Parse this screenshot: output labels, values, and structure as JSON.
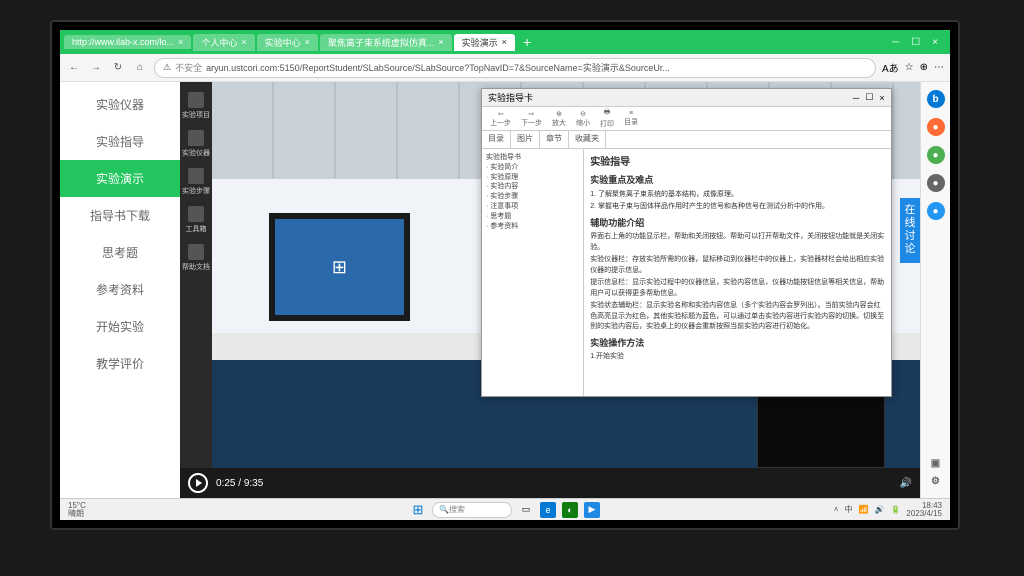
{
  "tabs": [
    {
      "label": "http://www.ilab-x.com/lo..."
    },
    {
      "label": "个人中心"
    },
    {
      "label": "实验中心"
    },
    {
      "label": "聚焦离子束系统虚拟仿真..."
    },
    {
      "label": "实验演示"
    }
  ],
  "addr": {
    "security": "不安全",
    "url": "aryun.ustcori.com:5150/ReportStudent/SLabSource/SLabSource?TopNavID=7&SourceName=实验演示&SourceUr..."
  },
  "leftMenu": [
    "实验仪器",
    "实验指导",
    "实验演示",
    "指导书下载",
    "思考题",
    "参考资料",
    "开始实验",
    "教学评价"
  ],
  "leftMenuActive": 2,
  "toolLeft": [
    "实验项目",
    "实验仪器",
    "实验步骤",
    "工具箱",
    "帮助文档"
  ],
  "guide": {
    "title": "实验指导卡",
    "toolbar": [
      "上一步",
      "下一步",
      "放大",
      "缩小",
      "打印",
      "目录"
    ],
    "tabs": [
      "目录",
      "图片",
      "章节",
      "收藏夹"
    ],
    "tree": [
      "实验指导书",
      "· 实验简介",
      "· 实验原理",
      "· 实验内容",
      "· 实验步骤",
      "· 注意事项",
      "· 思考题",
      "· 参考资料"
    ],
    "h1": "实验指导",
    "h2": "实验重点及难点",
    "p1": "1. 了解聚焦离子束系统的基本结构，成像原理。",
    "p2": "2. 掌握电子束与固体样品作用时产生的信号和各种信号在测试分析中的作用。",
    "h3": "辅助功能介绍",
    "p3": "界面右上角的功能显示栏，帮助和关闭按钮。帮助可以打开帮助文件，关闭按钮功能就是关闭实验。",
    "p4": "实验仪器栏：存放实验所需的仪器，鼠标移动到仪器栏中的仪器上，实验器材栏会给出相应实验仪器的提示信息。",
    "p5": "提示信息栏：显示实验过程中的仪器信息，实验内容信息，仪器功能按钮信息等相关信息，帮助用户可以获得更多帮助信息。",
    "p6": "实验状态辅助栏：显示实验名称和实验内容信息（多个实验内容会罗列出）。当前实验内容会红色高亮显示为红色，其他实验标题为蓝色，可以通过单击实验内容进行实验内容的切换。切换至别的实验内容后，实验桌上的仪器会重新按照当前实验内容进行初始化。",
    "h4": "实验操作方法",
    "p7": "1.开始实验"
  },
  "discuss": "在线讨论",
  "video": {
    "current": "0:25",
    "total": "9:35"
  },
  "taskbar": {
    "temp": "15°C",
    "weather": "晴朗",
    "search": "搜索",
    "time": "18:43",
    "date": "2023/4/15"
  }
}
